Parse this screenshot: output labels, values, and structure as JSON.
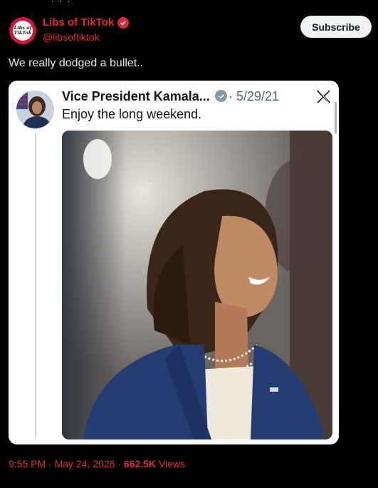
{
  "author": {
    "display_name": "Libs of TikTok",
    "handle": "@libsoftiktok",
    "avatar_text": "Libs of TikTok"
  },
  "subscribe_label": "Subscribe",
  "post_text": "We really dodged a bullet..",
  "quoted": {
    "display_name": "Vice President Kamala...",
    "date": "5/29/21",
    "text": "Enjoy the long weekend."
  },
  "meta": {
    "time": "9:55 PM",
    "date": "May 24, 2026",
    "views_count": "662.5K",
    "views_label": "Views"
  },
  "colors": {
    "brand_red": "#e02b32",
    "background": "#000000",
    "verified_gray": "#829aab"
  },
  "icons": [
    "verified-icon",
    "x-logo-icon"
  ]
}
